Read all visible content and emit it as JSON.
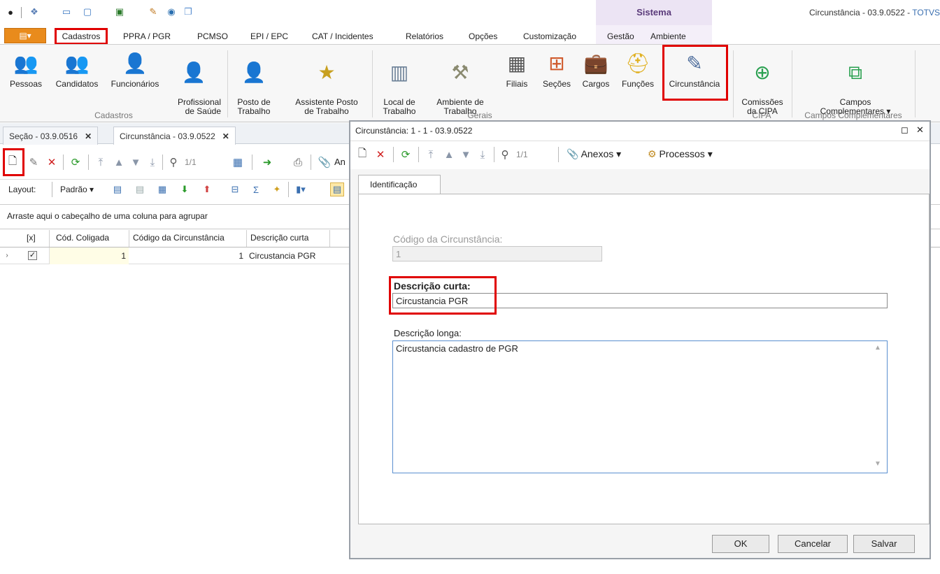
{
  "window": {
    "title": "Circunstância - 03.9.0522 - ",
    "title_brand": "TOTVS",
    "sistema": "Sistema"
  },
  "ribbon_tabs": [
    "Cadastros",
    "PPRA / PGR",
    "PCMSO",
    "EPI / EPC",
    "CAT / Incidentes",
    "Relatórios",
    "Opções",
    "Customização",
    "Gestão",
    "Ambiente"
  ],
  "ribbon": {
    "buttons": [
      {
        "label": "Pessoas",
        "icon": "people-icon"
      },
      {
        "label": "Candidatos",
        "icon": "candidates-icon"
      },
      {
        "label": "Funcionários",
        "icon": "employee-icon"
      },
      {
        "label": "Profissional\nde Saúde",
        "icon": "doctor-icon"
      },
      {
        "label": "Posto de\nTrabalho",
        "icon": "workstation-icon"
      },
      {
        "label": "Assistente Posto\nde Trabalho",
        "icon": "wizard-icon"
      },
      {
        "label": "Local de\nTrabalho",
        "icon": "building-icon"
      },
      {
        "label": "Ambiente de\nTrabalho",
        "icon": "workers-icon"
      },
      {
        "label": "Filiais",
        "icon": "branches-icon"
      },
      {
        "label": "Seções",
        "icon": "sections-icon"
      },
      {
        "label": "Cargos",
        "icon": "briefcase-icon"
      },
      {
        "label": "Funções",
        "icon": "helmet-icon"
      },
      {
        "label": "Circunstância",
        "icon": "notepad-pen-icon"
      },
      {
        "label": "Comissões\nda CIPA",
        "icon": "plus-circle-icon"
      },
      {
        "label": "Campos\nComplementares ▾",
        "icon": "window-add-icon"
      }
    ],
    "groups": [
      "Cadastros",
      "Gerais",
      "CIPA",
      "Campos Complementares"
    ]
  },
  "doc_tabs": [
    {
      "label": "Seção - 03.9.0516"
    },
    {
      "label": "Circunstância - 03.9.0522"
    }
  ],
  "toolbar": {
    "pager": "1/1",
    "anexos_short": "An"
  },
  "layout_bar": {
    "layout_label": "Layout:",
    "preset": "Padrão"
  },
  "grid": {
    "group_hint": "Arraste aqui o cabeçalho de uma coluna para agrupar",
    "columns": [
      "[x]",
      "Cód. Coligada",
      "Código da Circunstância",
      "Descrição curta"
    ],
    "rows": [
      {
        "checked": true,
        "coligada": "1",
        "codigo": "1",
        "descricao": "Circustancia PGR"
      }
    ]
  },
  "dialog": {
    "title": "Circunstância: 1 - 1 - 03.9.0522",
    "pager": "1/1",
    "anexos": "Anexos",
    "processos": "Processos",
    "tab": "Identificação",
    "codigo_label": "Código da Circunstância:",
    "codigo_value": "1",
    "desc_curta_label": "Descrição curta:",
    "desc_curta_value": "Circustancia PGR",
    "desc_longa_label": "Descrição longa:",
    "desc_longa_value": "Circustancia cadastro de PGR",
    "buttons": {
      "ok": "OK",
      "cancel": "Cancelar",
      "save": "Salvar"
    }
  }
}
